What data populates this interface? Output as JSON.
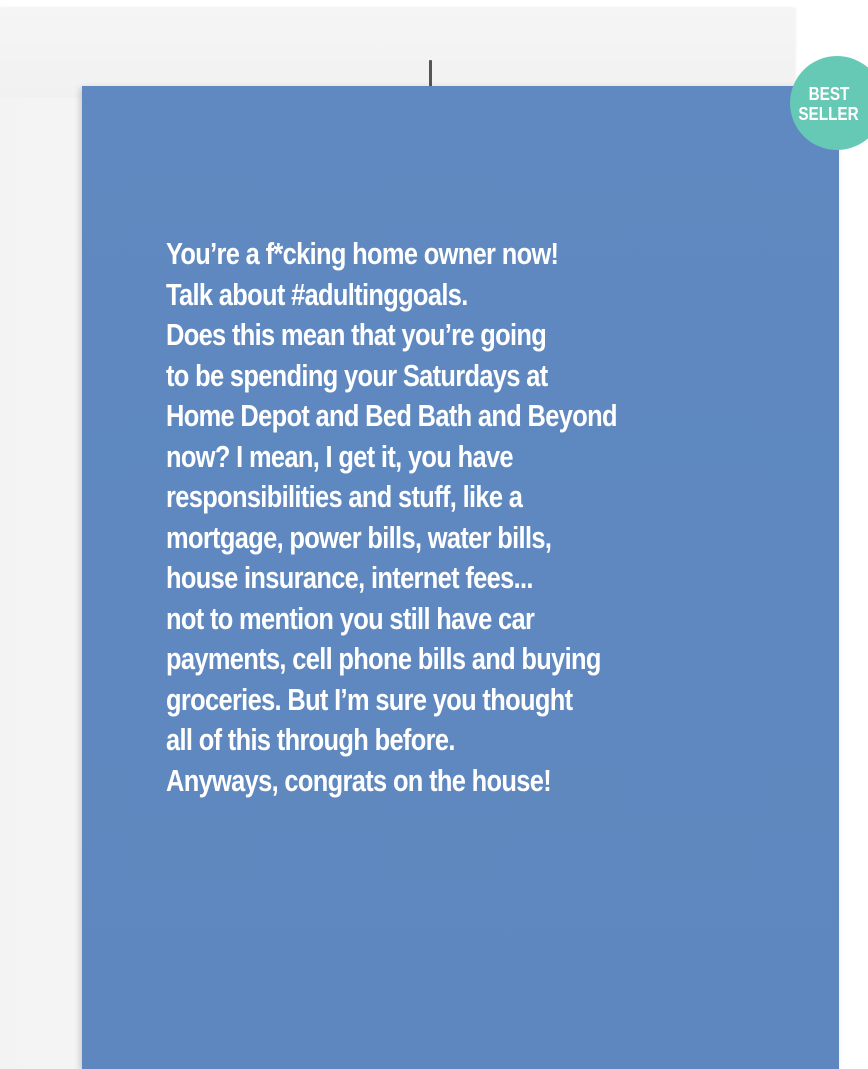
{
  "badge": {
    "line1": "BEST",
    "line2": "SELLER",
    "color": "#66c9b5"
  },
  "card": {
    "color": "#5f88bf",
    "text_color": "#ffffff",
    "lines": [
      "You’re a f*cking home owner now!",
      "Talk about #adultinggoals.",
      "Does this mean that you’re going",
      "to be spending your Saturdays at",
      "Home Depot and Bed Bath and Beyond",
      "now? I mean, I get it, you have",
      "responsibilities and stuff, like a",
      "mortgage, power bills, water bills,",
      "house insurance, internet fees...",
      "not to mention you still have car",
      "payments, cell phone bills and buying",
      "groceries. But I’m sure you thought",
      "all of this through before.",
      "Anyways, congrats on the house!"
    ]
  },
  "envelope": {
    "color": "#f5f5f5"
  }
}
